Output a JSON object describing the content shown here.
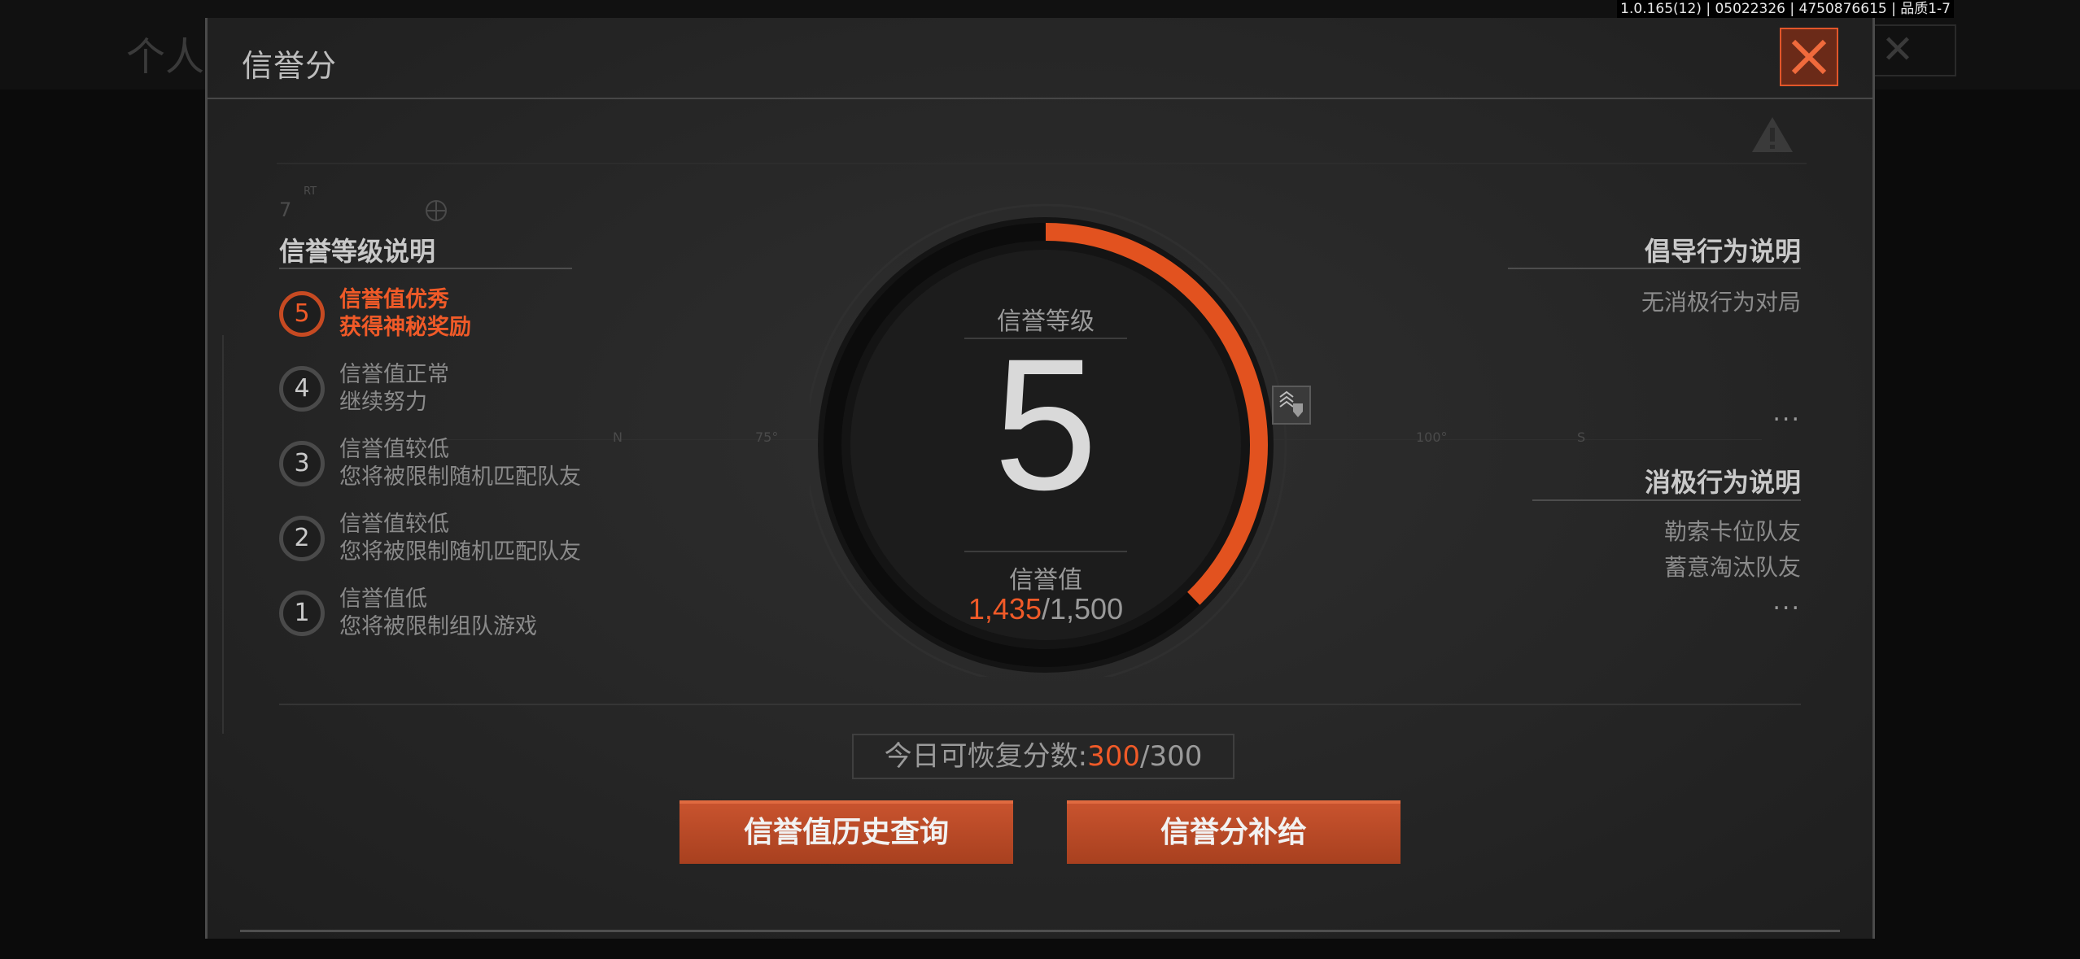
{
  "background": {
    "ghost_title": "个人"
  },
  "version_info": "1.0.165(12) | 05022326 | 4750876615 | 品质1-7",
  "dialog": {
    "title": "信誉分",
    "close_icon": "close-x-icon"
  },
  "levels_section": {
    "title": "信誉等级说明",
    "items": [
      {
        "level": "5",
        "line1": "信誉值优秀",
        "line2": "获得神秘奖励",
        "active": true
      },
      {
        "level": "4",
        "line1": "信誉值正常",
        "line2": "继续努力",
        "active": false
      },
      {
        "level": "3",
        "line1": "信誉值较低",
        "line2": "您将被限制随机匹配队友",
        "active": false
      },
      {
        "level": "2",
        "line1": "信誉值较低",
        "line2": "您将被限制随机匹配队友",
        "active": false
      },
      {
        "level": "1",
        "line1": "信誉值低",
        "line2": "您将被限制组队游戏",
        "active": false
      }
    ]
  },
  "gauge": {
    "level_label": "信誉等级",
    "level_value": "5",
    "score_label": "信誉值",
    "score_current": "1,435",
    "score_separator": "/",
    "score_max": "1,500",
    "progress_fraction": 0.378,
    "badge_icon": "rank-badge-icon"
  },
  "positive_section": {
    "title": "倡导行为说明",
    "items": [
      "无消极行为对局"
    ],
    "more": "..."
  },
  "negative_section": {
    "title": "消极行为说明",
    "items": [
      "勒索卡位队友",
      "蓄意淘汰队友"
    ],
    "more": "..."
  },
  "recover": {
    "label": "今日可恢复分数:",
    "current": "300",
    "separator": "/",
    "max": "300"
  },
  "buttons": {
    "history": "信誉值历史查询",
    "supply": "信誉分补给"
  },
  "deco": {
    "top_left_num": "7",
    "top_left_sup": "RT",
    "ticks": [
      "N",
      "75°",
      "100°",
      "S"
    ]
  },
  "colors": {
    "accent": "#f05a28",
    "panel": "#2a2a2a"
  }
}
